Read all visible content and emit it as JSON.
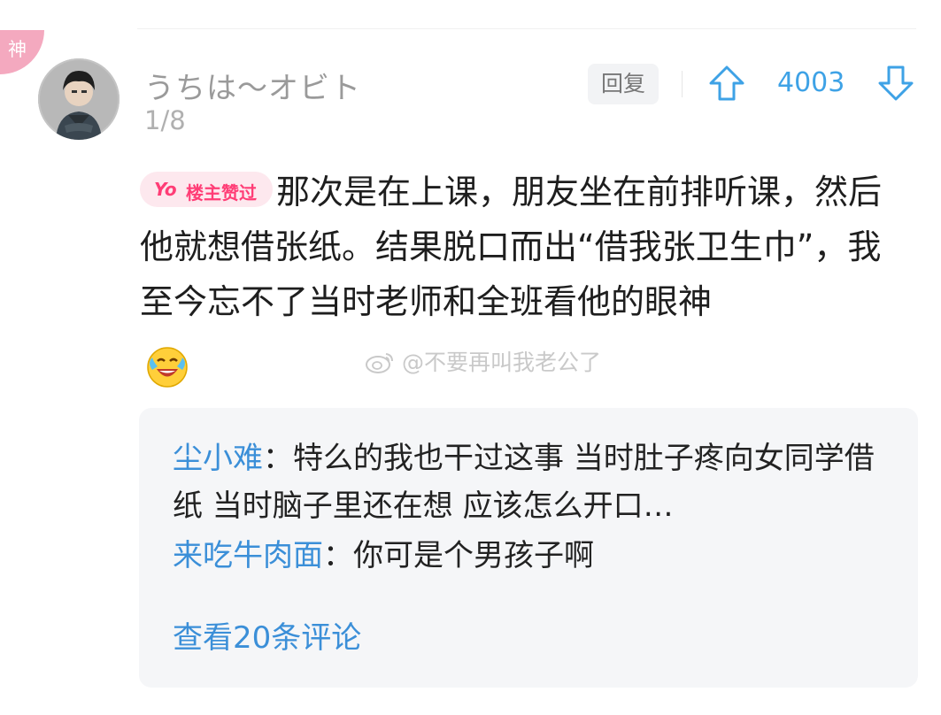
{
  "badge": {
    "label": "神"
  },
  "post": {
    "username": "うちは～オビト",
    "floor": "1/8",
    "reply_label": "回复",
    "vote_count": "4003",
    "op_badge": {
      "prefix": "Yo",
      "label": "楼主赞过"
    },
    "text": "那次是在上课，朋友坐在前排听课，然后他就想借张纸。结果脱口而出“借我张卫生巾”，我至今忘不了当时老师和全班看他的眼神",
    "emoji": "laugh-cry-emoji"
  },
  "watermark": {
    "text": "@不要再叫我老公了"
  },
  "replies": [
    {
      "author": "尘小难",
      "separator": "：",
      "text": "特么的我也干过这事  当时肚子疼向女同学借纸  当时脑子里还在想  应该怎么开口…"
    },
    {
      "author": "来吃牛肉面",
      "separator": "：",
      "text": "你可是个男孩子啊"
    }
  ],
  "view_more": "查看20条评论",
  "colors": {
    "accent_blue": "#3b8fd8",
    "vote_blue": "#3ea2e6",
    "badge_pink": "#ff3d76",
    "god_badge_bg": "#f4a9bf"
  }
}
